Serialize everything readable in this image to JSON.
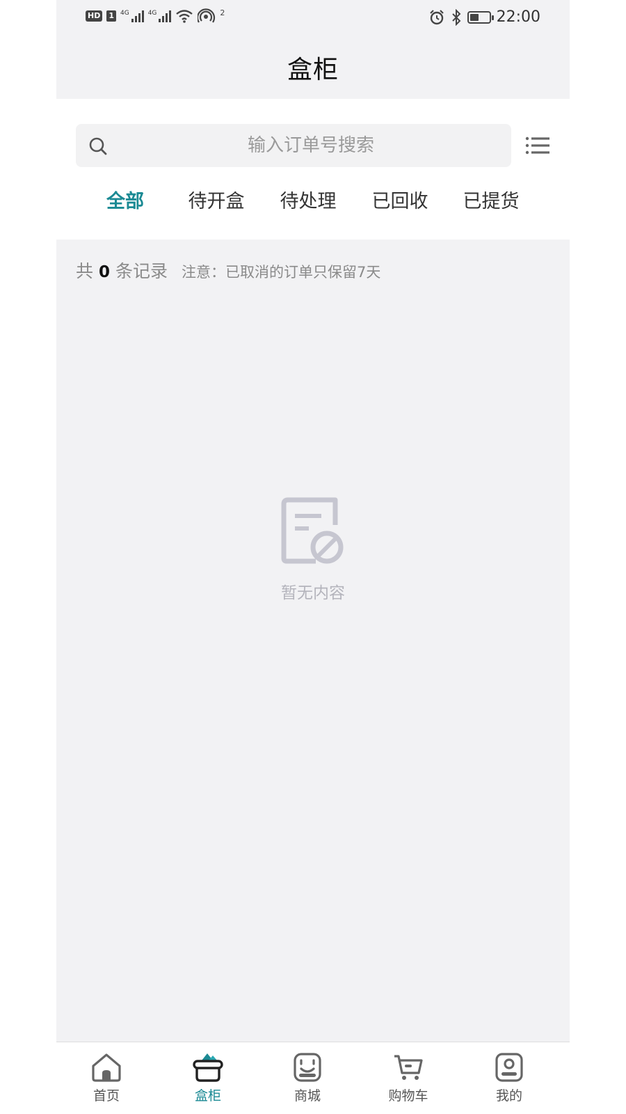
{
  "status_bar": {
    "hd_badge": "HD",
    "sim_label": "1",
    "network_1": "4G",
    "network_2": "4G",
    "hotspot_count": "2",
    "time": "22:00",
    "icons": [
      "signal-icon",
      "wifi-icon",
      "hotspot-icon",
      "alarm-icon",
      "bluetooth-icon",
      "battery-icon"
    ]
  },
  "header": {
    "title": "盒柜"
  },
  "search": {
    "placeholder": "输入订单号搜索",
    "icon": "search-icon",
    "menu_icon": "list-menu-icon"
  },
  "tabs": [
    {
      "label": "全部",
      "active": true
    },
    {
      "label": "待开盒",
      "active": false
    },
    {
      "label": "待处理",
      "active": false
    },
    {
      "label": "已回收",
      "active": false
    },
    {
      "label": "已提货",
      "active": false
    }
  ],
  "summary": {
    "prefix": "共",
    "count": "0",
    "suffix": "条记录",
    "note": "注意：已取消的订单只保留7天"
  },
  "empty_state": {
    "icon": "empty-document-icon",
    "text": "暂无内容"
  },
  "bottom_nav": [
    {
      "label": "首页",
      "icon": "home-icon",
      "active": false
    },
    {
      "label": "盒柜",
      "icon": "box-cabinet-icon",
      "active": true
    },
    {
      "label": "商城",
      "icon": "shop-icon",
      "active": false
    },
    {
      "label": "购物车",
      "icon": "cart-icon",
      "active": false
    },
    {
      "label": "我的",
      "icon": "profile-icon",
      "active": false
    }
  ],
  "colors": {
    "accent": "#1b8a94",
    "background": "#f2f2f4",
    "muted_text": "#9a9a9a"
  }
}
